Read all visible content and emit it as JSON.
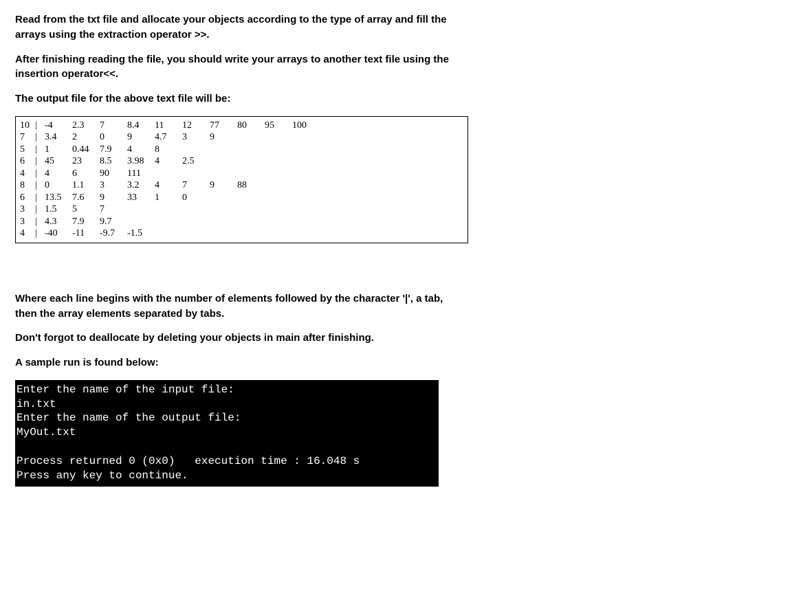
{
  "intro": {
    "para1": "Read from the txt file and allocate your objects according to the type of array and fill the arrays using the extraction operator >>.",
    "para2": "After finishing reading the file, you should write your arrays to another text file using the insertion operator<<.",
    "para3": "The output file for the above text file will be:"
  },
  "table": {
    "rows": [
      {
        "count": "10",
        "cells": [
          "-4",
          "2.3",
          "7",
          "8.4",
          "11",
          "12",
          "77",
          "80",
          "95",
          "100"
        ]
      },
      {
        "count": "7",
        "cells": [
          "3.4",
          "2",
          "0",
          "9",
          "4.7",
          "3",
          "9",
          "",
          "",
          ""
        ]
      },
      {
        "count": "5",
        "cells": [
          "1",
          "0.44",
          "7.9",
          "4",
          "8",
          "",
          "",
          "",
          "",
          ""
        ]
      },
      {
        "count": "6",
        "cells": [
          "45",
          "23",
          "8.5",
          "3.98",
          "4",
          "2.5",
          "",
          "",
          "",
          ""
        ]
      },
      {
        "count": "4",
        "cells": [
          "4",
          "6",
          "90",
          "111",
          "",
          "",
          "",
          "",
          "",
          ""
        ]
      },
      {
        "count": "8",
        "cells": [
          "0",
          "1.1",
          "3",
          "3.2",
          "4",
          "7",
          "9",
          "88",
          "",
          ""
        ]
      },
      {
        "count": "6",
        "cells": [
          "13.5",
          "7.6",
          "9",
          "33",
          "1",
          "0",
          "",
          "",
          "",
          ""
        ]
      },
      {
        "count": "3",
        "cells": [
          "1.5",
          "5",
          "7",
          "",
          "",
          "",
          "",
          "",
          "",
          ""
        ]
      },
      {
        "count": "3",
        "cells": [
          "4.3",
          "7.9",
          "9.7",
          "",
          "",
          "",
          "",
          "",
          "",
          ""
        ]
      },
      {
        "count": "4",
        "cells": [
          "-40",
          "-11",
          "-9.7",
          "-1.5",
          "",
          "",
          "",
          "",
          "",
          ""
        ]
      }
    ],
    "pipe": "|"
  },
  "notes": {
    "explain": "Where each line begins with the number of elements followed by the character '|', a tab, then the array elements separated by tabs.",
    "dealloc": "Don't forgot to deallocate by deleting your objects in main after finishing.",
    "sample": "A sample run is found below:"
  },
  "terminal": {
    "text": "Enter the name of the input file:\nin.txt\nEnter the name of the output file:\nMyOut.txt\n\nProcess returned 0 (0x0)   execution time : 16.048 s\nPress any key to continue."
  }
}
